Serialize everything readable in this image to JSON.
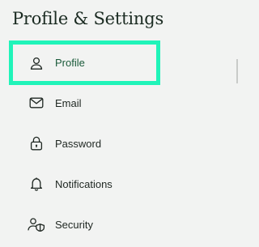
{
  "page": {
    "title": "Profile & Settings"
  },
  "sidebar": {
    "items": [
      {
        "label": "Profile",
        "icon": "user-icon",
        "active": true
      },
      {
        "label": "Email",
        "icon": "envelope-icon",
        "active": false
      },
      {
        "label": "Password",
        "icon": "lock-icon",
        "active": false
      },
      {
        "label": "Notifications",
        "icon": "bell-icon",
        "active": false
      },
      {
        "label": "Security",
        "icon": "user-shield-icon",
        "active": false
      }
    ]
  },
  "colors": {
    "background": "#f2f3f2",
    "focus_ring": "#20f4b9",
    "active_text": "#1a5a3a",
    "text": "#1f2722"
  }
}
